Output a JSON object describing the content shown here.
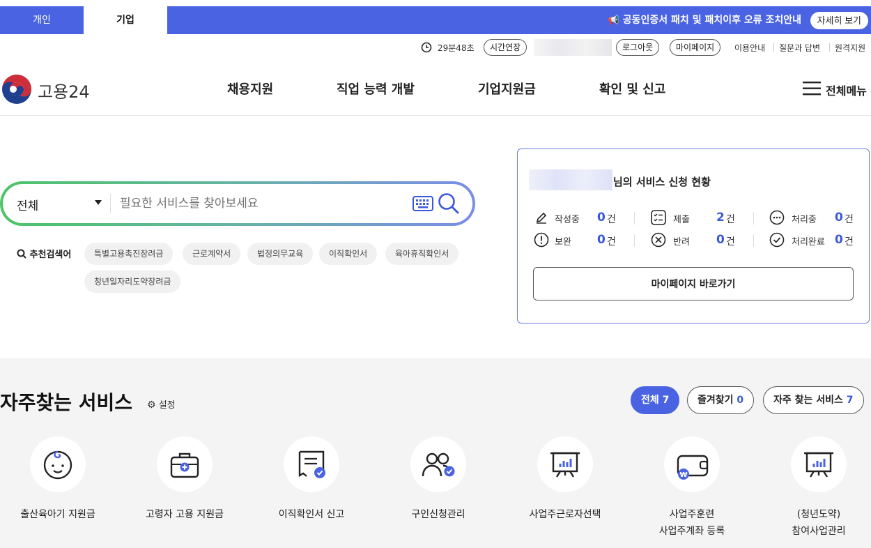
{
  "topbar": {
    "tabs": [
      {
        "label": "개인"
      },
      {
        "label": "기업"
      }
    ],
    "notice": "공동인증서 패치 및 패치이후 오류 조치안내",
    "notice_button": "자세히 보기"
  },
  "utility": {
    "timer": "29분48초",
    "extend": "시간연장",
    "logout": "로그아웃",
    "mypage": "마이페이지",
    "links": [
      "이용안내",
      "질문과 답변",
      "원격지원"
    ]
  },
  "header": {
    "logo_text": "고용24",
    "nav": [
      "채용지원",
      "직업 능력 개발",
      "기업지원금",
      "확인 및 신고"
    ],
    "all_menu": "전체메뉴"
  },
  "search": {
    "category": "전체",
    "placeholder": "필요한 서비스를 찾아보세요",
    "recommend_label": "추천검색어",
    "keywords": [
      "특별고용촉진장려금",
      "근로계약서",
      "법정의무교육",
      "이직확인서",
      "육아휴직확인서",
      "청년일자리도약장려금"
    ]
  },
  "status_card": {
    "title": "님의 서비스 신청 현황",
    "items": [
      {
        "label": "작성중",
        "count": "0",
        "unit": "건",
        "icon": "pencil-icon"
      },
      {
        "label": "제출",
        "count": "2",
        "unit": "건",
        "icon": "checklist-icon"
      },
      {
        "label": "처리중",
        "count": "0",
        "unit": "건",
        "icon": "ellipsis-icon"
      },
      {
        "label": "보완",
        "count": "0",
        "unit": "건",
        "icon": "exclamation-icon"
      },
      {
        "label": "반려",
        "count": "0",
        "unit": "건",
        "icon": "x-circle-icon"
      },
      {
        "label": "처리완료",
        "count": "0",
        "unit": "건",
        "icon": "check-circle-icon"
      }
    ],
    "mypage_button": "마이페이지 바로가기"
  },
  "services": {
    "title": "자주찾는 서비스",
    "settings": "설정",
    "filters": [
      {
        "label": "전체",
        "count": "7"
      },
      {
        "label": "즐겨찾기",
        "count": "0"
      },
      {
        "label": "자주 찾는 서비스",
        "count": "7"
      }
    ],
    "items": [
      {
        "label": "출산육아기 지원금",
        "icon": "baby-icon"
      },
      {
        "label": "고령자 고용 지원금",
        "icon": "briefcase-icon"
      },
      {
        "label": "이직확인서 신고",
        "icon": "document-check-icon"
      },
      {
        "label": "구인신청관리",
        "icon": "people-check-icon"
      },
      {
        "label": "사업주근로자선택",
        "icon": "presentation-chart-icon"
      },
      {
        "label": "사업주훈련",
        "label2": "사업주계좌 등록",
        "icon": "wallet-won-icon"
      },
      {
        "label": "(청년도약)",
        "label2": "참여사업관리",
        "icon": "presentation-chart-icon"
      }
    ]
  },
  "colors": {
    "brand": "#4a63e2",
    "accent_num": "#3b58d8",
    "section_bg": "#f4f4f4"
  }
}
